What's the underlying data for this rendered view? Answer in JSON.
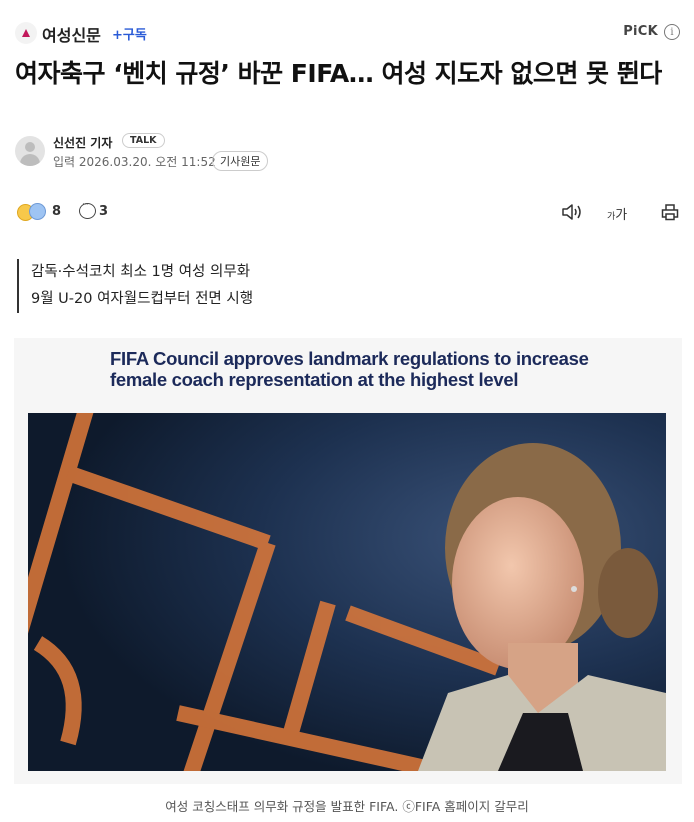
{
  "header": {
    "press_name": "여성신문",
    "subscribe_label": "+구독",
    "pick_label": "PiCK",
    "info_symbol": "i"
  },
  "article": {
    "title": "여자축구 ‘벤치 규정’ 바꾼 FIFA… 여성 지도자 없으면 못 뛴다",
    "reporter": "신선진 기자",
    "talk_label": "TALK",
    "date": "입력 2026.03.20. 오전 11:52",
    "original_label": "기사원문",
    "summary": [
      "감독·수석코치 최소 1명 여성 의무화",
      "9월 U-20 여자월드컵부터 전면 시행"
    ]
  },
  "actions": {
    "reaction_count": "8",
    "comment_count": "3",
    "font_size_label_small": "가",
    "font_size_label_large": "가"
  },
  "photo": {
    "headline_line1": "FIFA Council approves landmark regulations to increase",
    "headline_line2": "female coach representation at the highest level",
    "caption": "여성 코칭스태프 의무화 규정을 발표한 FIFA. ⓒFIFA 홈페이지 갈무리"
  },
  "colors": {
    "accent": "#2a5bd7",
    "headline_navy": "#1c2a5a",
    "photo_background": "#15253d",
    "photo_orange": "#e07a3a"
  },
  "icons": [
    "press-logo-icon",
    "info-icon",
    "avatar-icon",
    "emoji-reaction-icon",
    "comment-icon",
    "speaker-icon",
    "print-icon"
  ]
}
